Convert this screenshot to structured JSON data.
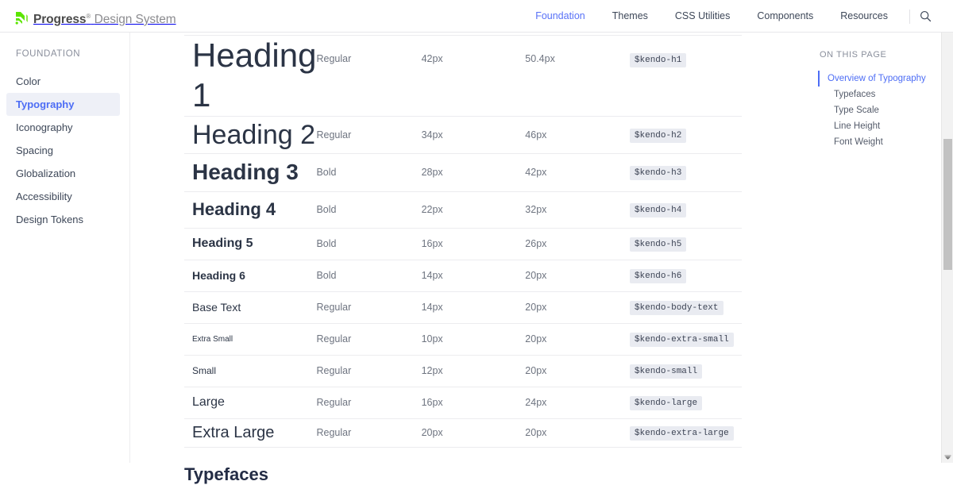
{
  "header": {
    "brand_name": "Progress",
    "brand_reg": "®",
    "brand_suffix": "Design System",
    "logo_icon": "progress-logo-icon",
    "nav": [
      {
        "label": "Foundation",
        "active": true
      },
      {
        "label": "Themes",
        "active": false
      },
      {
        "label": "CSS Utilities",
        "active": false
      },
      {
        "label": "Components",
        "active": false
      },
      {
        "label": "Resources",
        "active": false
      }
    ],
    "search_icon": "search-icon"
  },
  "sidebar": {
    "title": "FOUNDATION",
    "items": [
      {
        "label": "Color",
        "active": false
      },
      {
        "label": "Typography",
        "active": true
      },
      {
        "label": "Iconography",
        "active": false
      },
      {
        "label": "Spacing",
        "active": false
      },
      {
        "label": "Globalization",
        "active": false
      },
      {
        "label": "Accessibility",
        "active": false
      },
      {
        "label": "Design Tokens",
        "active": false
      }
    ]
  },
  "main": {
    "section_heading": "Typefaces",
    "table": {
      "rows": [
        {
          "sample": "Heading 1",
          "weight": "Regular",
          "size": "42px",
          "line_height": "50.4px",
          "token": "$kendo-h1"
        },
        {
          "sample": "Heading 2",
          "weight": "Regular",
          "size": "34px",
          "line_height": "46px",
          "token": "$kendo-h2"
        },
        {
          "sample": "Heading 3",
          "weight": "Bold",
          "size": "28px",
          "line_height": "42px",
          "token": "$kendo-h3"
        },
        {
          "sample": "Heading 4",
          "weight": "Bold",
          "size": "22px",
          "line_height": "32px",
          "token": "$kendo-h4"
        },
        {
          "sample": "Heading 5",
          "weight": "Bold",
          "size": "16px",
          "line_height": "26px",
          "token": "$kendo-h5"
        },
        {
          "sample": "Heading 6",
          "weight": "Bold",
          "size": "14px",
          "line_height": "20px",
          "token": "$kendo-h6"
        },
        {
          "sample": "Base Text",
          "weight": "Regular",
          "size": "14px",
          "line_height": "20px",
          "token": "$kendo-body-text"
        },
        {
          "sample": "Extra Small",
          "weight": "Regular",
          "size": "10px",
          "line_height": "20px",
          "token": "$kendo-extra-small"
        },
        {
          "sample": "Small",
          "weight": "Regular",
          "size": "12px",
          "line_height": "20px",
          "token": "$kendo-small"
        },
        {
          "sample": "Large",
          "weight": "Regular",
          "size": "16px",
          "line_height": "24px",
          "token": "$kendo-large"
        },
        {
          "sample": "Extra Large",
          "weight": "Regular",
          "size": "20px",
          "line_height": "20px",
          "token": "$kendo-extra-large"
        }
      ]
    }
  },
  "toc": {
    "title": "ON THIS PAGE",
    "items": [
      {
        "label": "Overview of Typography",
        "active": true
      },
      {
        "label": "Typefaces",
        "active": false
      },
      {
        "label": "Type Scale",
        "active": false
      },
      {
        "label": "Line Height",
        "active": false
      },
      {
        "label": "Font Weight",
        "active": false
      }
    ]
  },
  "colors": {
    "accent": "#4d6df5",
    "brand_green": "#5ce500",
    "text": "#2b3445",
    "muted": "#6e7480",
    "token_bg": "#e9ebf1"
  }
}
